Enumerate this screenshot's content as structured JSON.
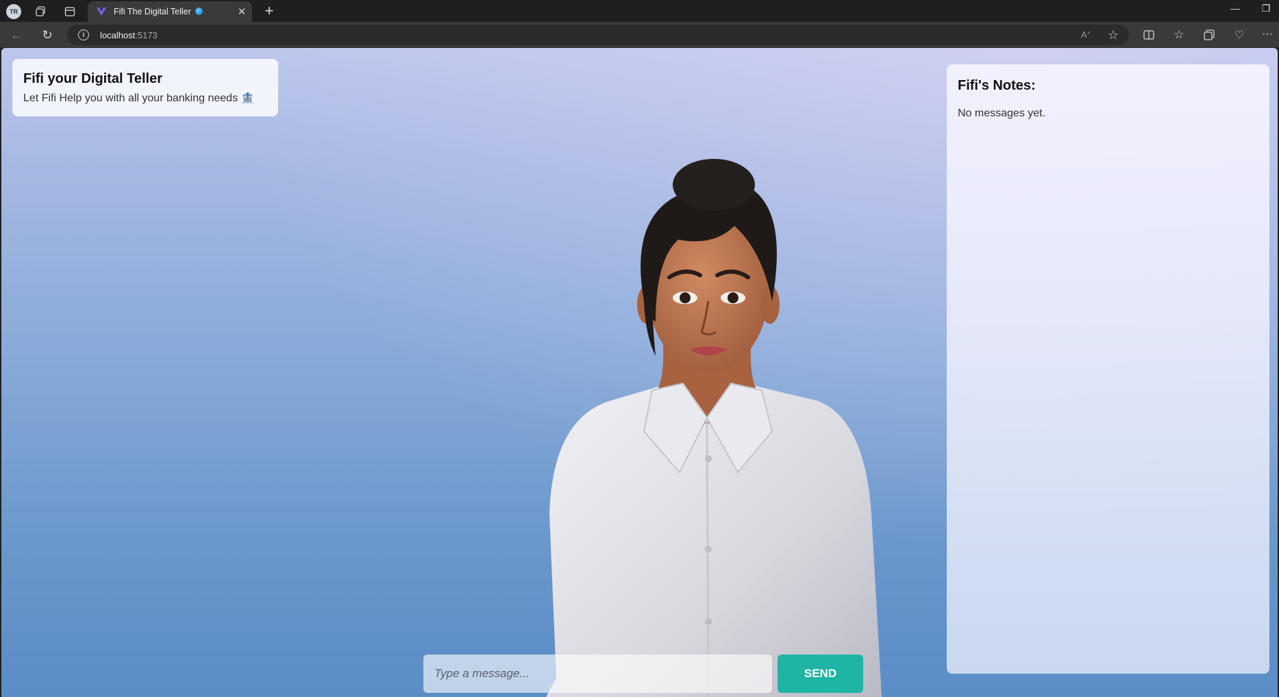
{
  "browser": {
    "profile_initials": "TR",
    "tab_title": "Fifi The Digital Teller",
    "url_host": "localhost",
    "url_port": ":5173",
    "icons": [
      "workspaces-icon",
      "tab-actions-icon",
      "tab-favicon",
      "globe-emoji-icon",
      "close-tab-icon",
      "new-tab-icon",
      "minimize-icon",
      "restore-icon",
      "back-icon",
      "reload-icon",
      "site-info-icon",
      "read-aloud-icon",
      "favorite-star-icon",
      "split-screen-icon",
      "favorites-icon",
      "collections-icon",
      "browser-essentials-icon",
      "more-menu-icon"
    ]
  },
  "header": {
    "title": "Fifi your Digital Teller",
    "subtitle": "Let Fifi Help you with all your banking needs",
    "subtitle_icon": "bank-emoji-icon"
  },
  "notes": {
    "title": "Fifi's Notes:",
    "empty_text": "No messages yet."
  },
  "chat": {
    "placeholder": "Type a message...",
    "send_label": "SEND"
  },
  "colors": {
    "send_button": "#1fb5a5",
    "sky_top": "#bcc6ec",
    "sky_bottom": "#5a8cc6"
  }
}
